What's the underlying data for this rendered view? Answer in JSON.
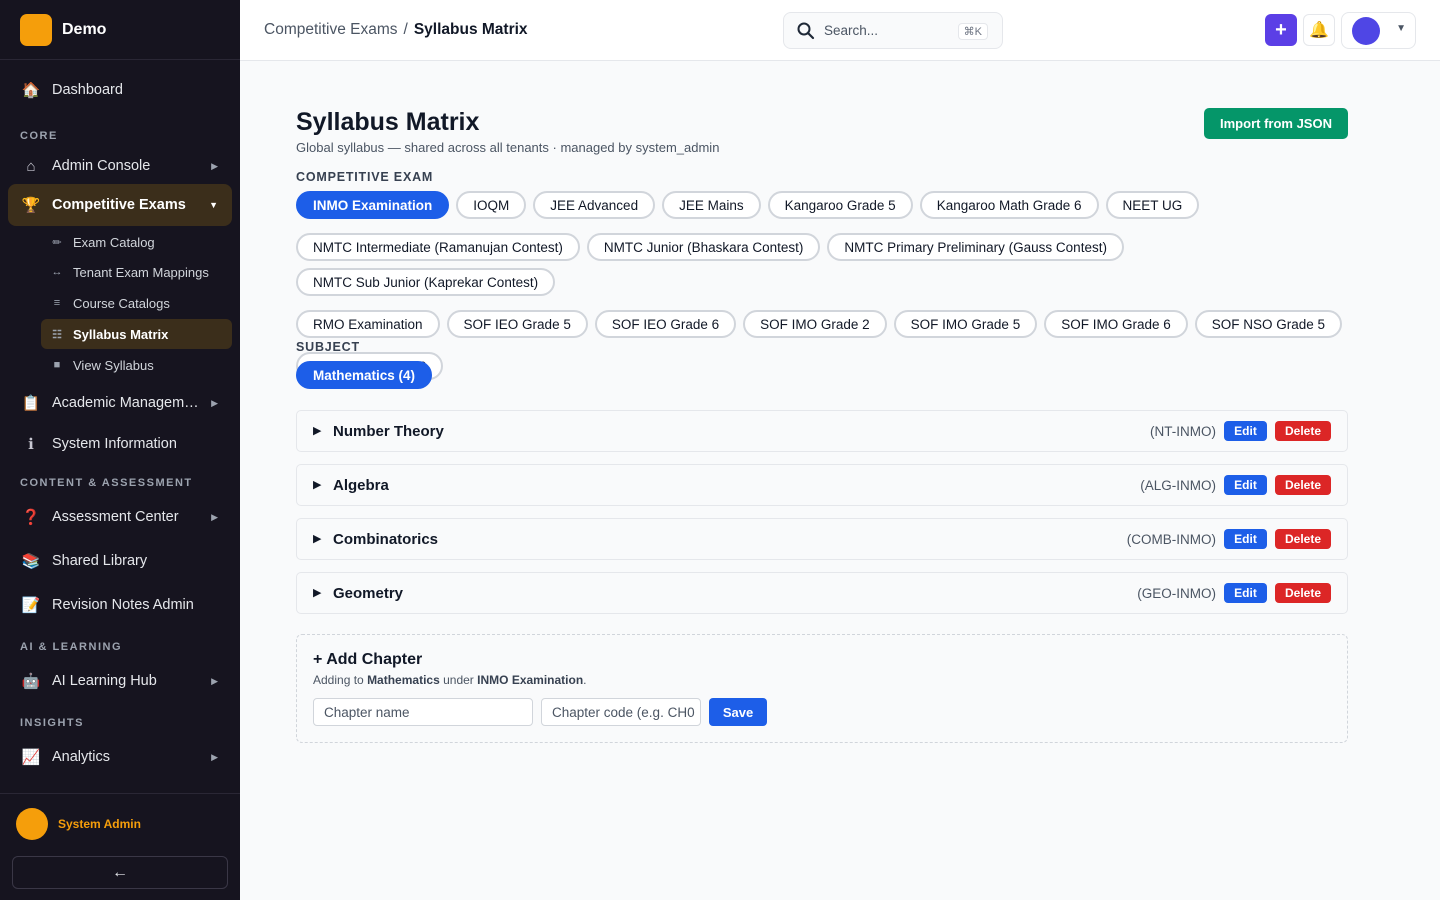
{
  "brand": {
    "name": "Demo"
  },
  "sidebar": {
    "dashboard": "Dashboard",
    "sections": {
      "core": "CORE",
      "content": "CONTENT & ASSESSMENT",
      "ai": "AI & LEARNING",
      "insights": "INSIGHTS"
    },
    "admin_console": "Admin Console",
    "competitive_exams": "Competitive Exams",
    "sub_items": [
      "Exam Catalog",
      "Tenant Exam Mappings",
      "Course Catalogs",
      "Syllabus Matrix",
      "View Syllabus"
    ],
    "academic": "Academic Managem…",
    "system_info": "System Information",
    "assessment_center": "Assessment Center",
    "shared_library": "Shared Library",
    "revision_notes": "Revision Notes Admin",
    "ai_hub": "AI Learning Hub",
    "analytics": "Analytics",
    "user_name": "System Admin",
    "collapse": "←"
  },
  "header": {
    "breadcrumb_parent": "Competitive Exams",
    "breadcrumb_sep": "/",
    "breadcrumb_current": "Syllabus Matrix",
    "search_placeholder": "Search...",
    "search_shortcut": "⌘K",
    "plus": "+"
  },
  "page": {
    "title": "Syllabus Matrix",
    "subtitle": "Global syllabus — shared across all tenants · managed by system_admin",
    "import_button": "Import from JSON",
    "exam_label": "COMPETITIVE EXAM",
    "subject_label": "SUBJECT",
    "subject_chip": "Mathematics (4)"
  },
  "exams": [
    "INMO Examination",
    "IOQM",
    "JEE Advanced",
    "JEE Mains",
    "Kangaroo Grade 5",
    "Kangaroo Math Grade 6",
    "NEET UG",
    "NMTC Intermediate (Ramanujan Contest)",
    "NMTC Junior (Bhaskara Contest)",
    "NMTC Primary Preliminary (Gauss Contest)",
    "NMTC Sub Junior (Kaprekar Contest)",
    "RMO Examination",
    "SOF IEO Grade 5",
    "SOF IEO Grade 6",
    "SOF IMO Grade 2",
    "SOF IMO Grade 5",
    "SOF IMO Grade 6",
    "SOF NSO Grade 5",
    "SOF NSO Grade 6"
  ],
  "selected_exam": "INMO Examination",
  "chapters": [
    {
      "name": "Number Theory",
      "code": "(NT-INMO)"
    },
    {
      "name": "Algebra",
      "code": "(ALG-INMO)"
    },
    {
      "name": "Combinatorics",
      "code": "(COMB-INMO)"
    },
    {
      "name": "Geometry",
      "code": "(GEO-INMO)"
    }
  ],
  "chapter_actions": {
    "edit": "Edit",
    "delete": "Delete"
  },
  "add_chapter": {
    "title": "+ Add Chapter",
    "desc_prefix": "Adding to",
    "desc_subject": "Mathematics",
    "desc_mid": "under",
    "desc_exam": "INMO Examination",
    "desc_suffix": ".",
    "name_placeholder": "Chapter name",
    "code_placeholder": "Chapter code (e.g. CH0",
    "save": "Save"
  },
  "colors": {
    "accent": "#1d5ee8",
    "brand": "#f59e0b",
    "success": "#059669",
    "danger": "#dc2626",
    "sidebar_bg": "#16141f"
  }
}
